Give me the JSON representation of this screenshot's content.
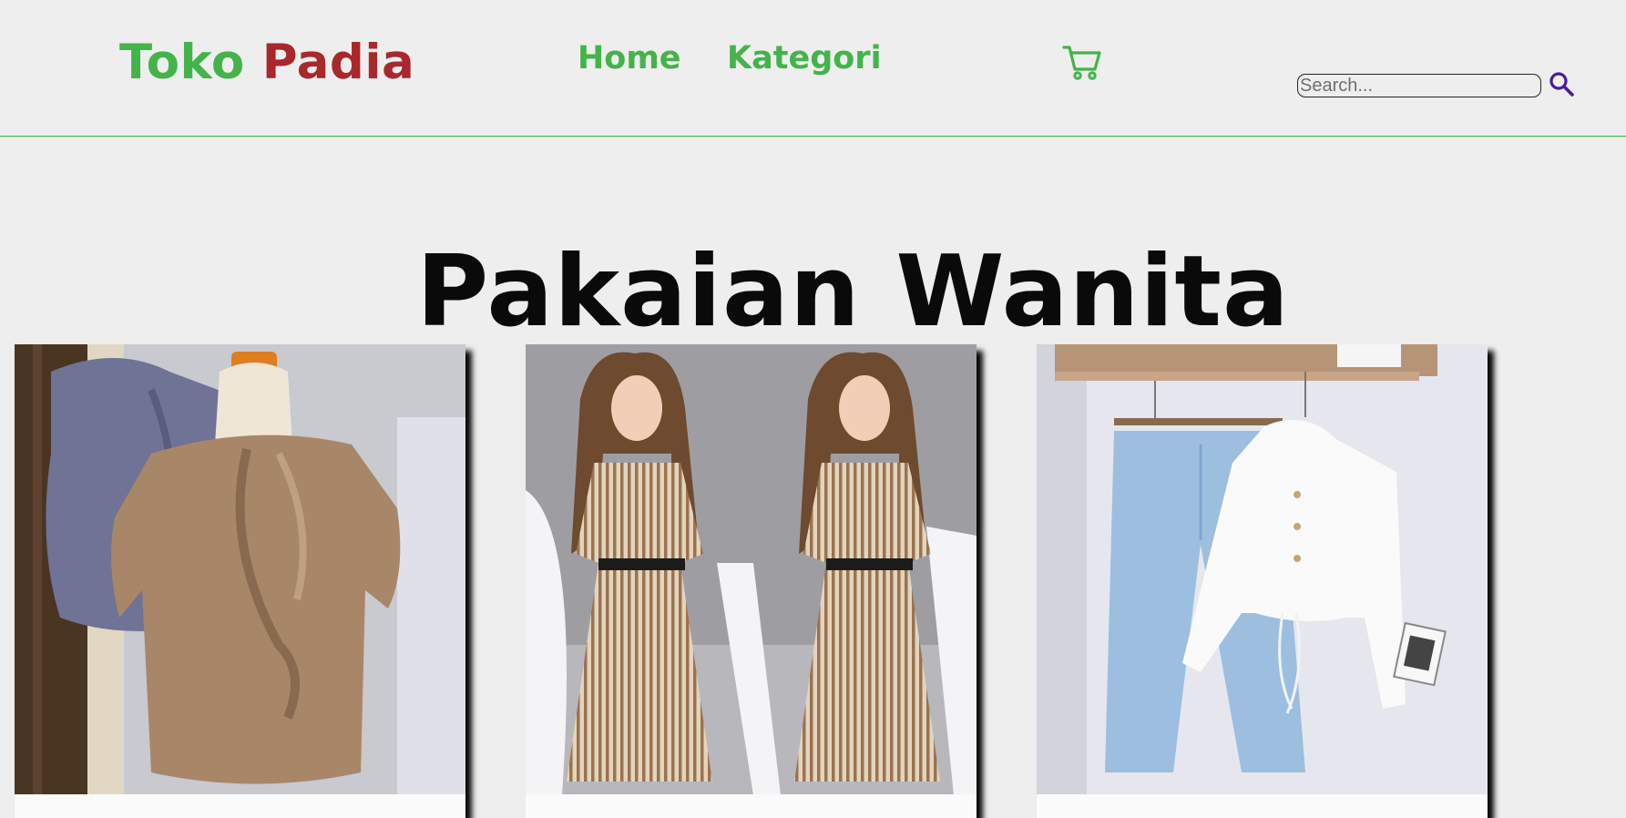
{
  "brand": {
    "part1": "Toko ",
    "part2": "Padia",
    "color1": "#44b34a",
    "color2": "#a8282c"
  },
  "nav": {
    "home": "Home",
    "kategori": "Kategori"
  },
  "cart": {
    "icon": "shopping-cart-icon"
  },
  "search": {
    "placeholder": "Search...",
    "icon": "search-icon",
    "icon_color": "#4a1a9c"
  },
  "page": {
    "heading": "Pakaian Wanita"
  },
  "products": [
    {
      "image": "brown-blouse-photo"
    },
    {
      "image": "striped-dress-photo"
    },
    {
      "image": "jeans-white-hoodie-photo"
    }
  ]
}
